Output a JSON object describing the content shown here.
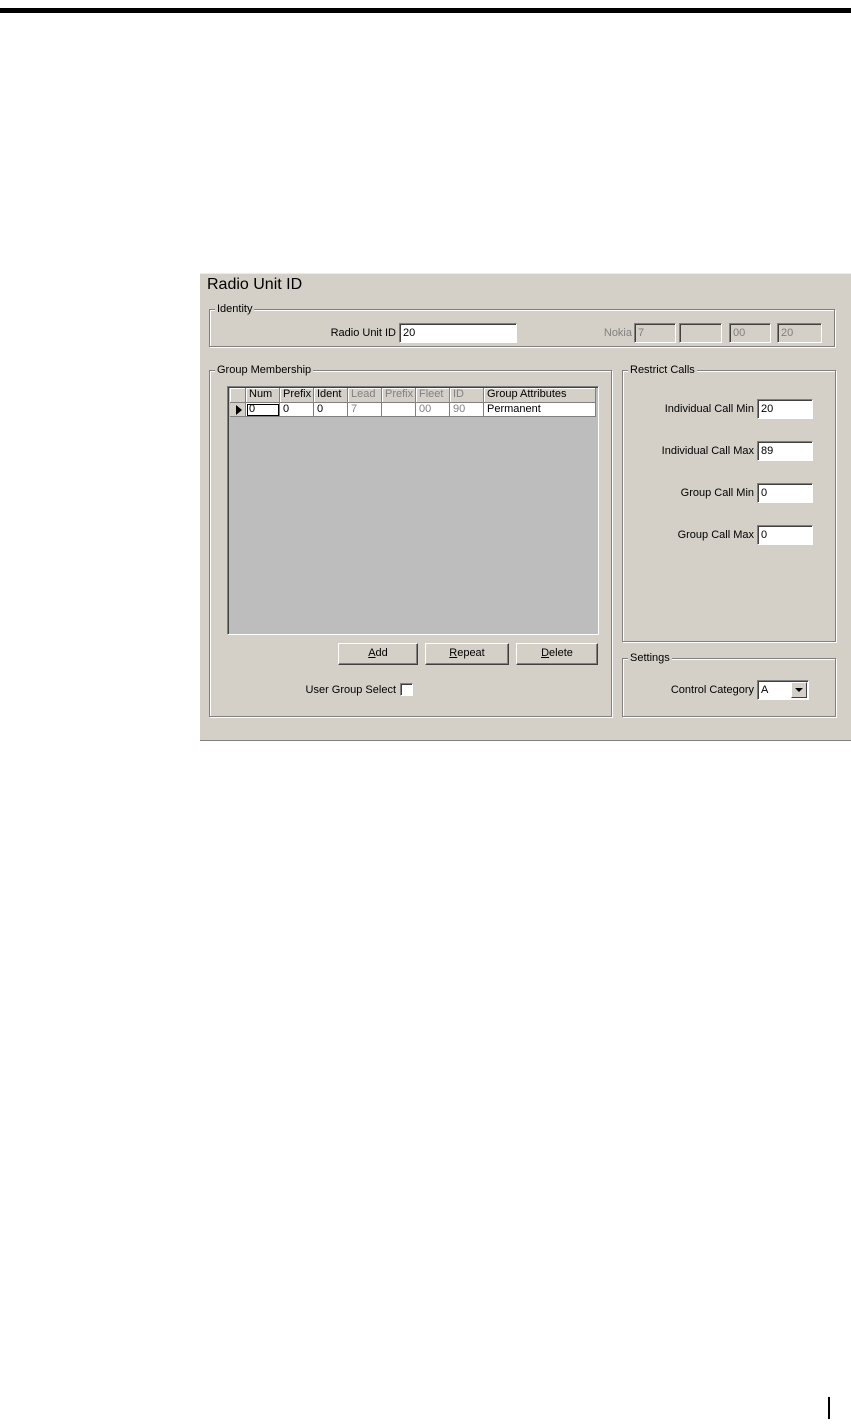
{
  "panel": {
    "title": "Radio Unit ID",
    "identity": {
      "title": "Identity",
      "radio_unit_id_label": "Radio Unit ID",
      "radio_unit_id_value": "20",
      "nokia_label": "Nokia",
      "nokia_fields": [
        "7",
        "",
        "00",
        "20"
      ]
    },
    "group_membership": {
      "title": "Group Membership",
      "columns": [
        "Num",
        "Prefix",
        "Ident",
        "Lead",
        "Prefix",
        "Fleet",
        "ID",
        "Group Attributes"
      ],
      "rows": [
        [
          "0",
          "0",
          "0",
          "7",
          "",
          "00",
          "90",
          "Permanent"
        ]
      ],
      "buttons": {
        "add": {
          "pre": "",
          "key": "A",
          "post": "dd"
        },
        "repeat": {
          "pre": "",
          "key": "R",
          "post": "epeat"
        },
        "delete": {
          "pre": "",
          "key": "D",
          "post": "elete"
        }
      },
      "user_group_select_label": "User Group Select",
      "user_group_select_checked": false
    },
    "restrict_calls": {
      "title": "Restrict Calls",
      "individual_call_min_label": "Individual Call Min",
      "individual_call_min_value": "20",
      "individual_call_max_label": "Individual Call Max",
      "individual_call_max_value": "89",
      "group_call_min_label": "Group Call Min",
      "group_call_min_value": "0",
      "group_call_max_label": "Group Call Max",
      "group_call_max_value": "0"
    },
    "settings": {
      "title": "Settings",
      "control_category_label": "Control Category",
      "control_category_value": "A"
    }
  },
  "colors": {
    "dialog_bg": "#d4d0c8",
    "grid_bg": "#bdbdbd",
    "disabled_text": "#808080"
  }
}
